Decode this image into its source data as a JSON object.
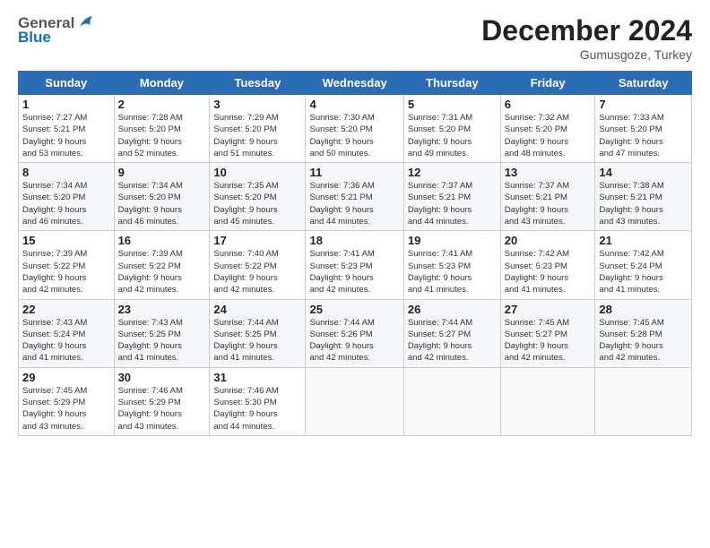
{
  "logo": {
    "line1": "General",
    "line2": "Blue"
  },
  "header": {
    "month_year": "December 2024",
    "location": "Gumusgoze, Turkey"
  },
  "days_of_week": [
    "Sunday",
    "Monday",
    "Tuesday",
    "Wednesday",
    "Thursday",
    "Friday",
    "Saturday"
  ],
  "weeks": [
    [
      {
        "day": "1",
        "info": "Sunrise: 7:27 AM\nSunset: 5:21 PM\nDaylight: 9 hours\nand 53 minutes."
      },
      {
        "day": "2",
        "info": "Sunrise: 7:28 AM\nSunset: 5:20 PM\nDaylight: 9 hours\nand 52 minutes."
      },
      {
        "day": "3",
        "info": "Sunrise: 7:29 AM\nSunset: 5:20 PM\nDaylight: 9 hours\nand 51 minutes."
      },
      {
        "day": "4",
        "info": "Sunrise: 7:30 AM\nSunset: 5:20 PM\nDaylight: 9 hours\nand 50 minutes."
      },
      {
        "day": "5",
        "info": "Sunrise: 7:31 AM\nSunset: 5:20 PM\nDaylight: 9 hours\nand 49 minutes."
      },
      {
        "day": "6",
        "info": "Sunrise: 7:32 AM\nSunset: 5:20 PM\nDaylight: 9 hours\nand 48 minutes."
      },
      {
        "day": "7",
        "info": "Sunrise: 7:33 AM\nSunset: 5:20 PM\nDaylight: 9 hours\nand 47 minutes."
      }
    ],
    [
      {
        "day": "8",
        "info": "Sunrise: 7:34 AM\nSunset: 5:20 PM\nDaylight: 9 hours\nand 46 minutes."
      },
      {
        "day": "9",
        "info": "Sunrise: 7:34 AM\nSunset: 5:20 PM\nDaylight: 9 hours\nand 46 minutes."
      },
      {
        "day": "10",
        "info": "Sunrise: 7:35 AM\nSunset: 5:20 PM\nDaylight: 9 hours\nand 45 minutes."
      },
      {
        "day": "11",
        "info": "Sunrise: 7:36 AM\nSunset: 5:21 PM\nDaylight: 9 hours\nand 44 minutes."
      },
      {
        "day": "12",
        "info": "Sunrise: 7:37 AM\nSunset: 5:21 PM\nDaylight: 9 hours\nand 44 minutes."
      },
      {
        "day": "13",
        "info": "Sunrise: 7:37 AM\nSunset: 5:21 PM\nDaylight: 9 hours\nand 43 minutes."
      },
      {
        "day": "14",
        "info": "Sunrise: 7:38 AM\nSunset: 5:21 PM\nDaylight: 9 hours\nand 43 minutes."
      }
    ],
    [
      {
        "day": "15",
        "info": "Sunrise: 7:39 AM\nSunset: 5:22 PM\nDaylight: 9 hours\nand 42 minutes."
      },
      {
        "day": "16",
        "info": "Sunrise: 7:39 AM\nSunset: 5:22 PM\nDaylight: 9 hours\nand 42 minutes."
      },
      {
        "day": "17",
        "info": "Sunrise: 7:40 AM\nSunset: 5:22 PM\nDaylight: 9 hours\nand 42 minutes."
      },
      {
        "day": "18",
        "info": "Sunrise: 7:41 AM\nSunset: 5:23 PM\nDaylight: 9 hours\nand 42 minutes."
      },
      {
        "day": "19",
        "info": "Sunrise: 7:41 AM\nSunset: 5:23 PM\nDaylight: 9 hours\nand 41 minutes."
      },
      {
        "day": "20",
        "info": "Sunrise: 7:42 AM\nSunset: 5:23 PM\nDaylight: 9 hours\nand 41 minutes."
      },
      {
        "day": "21",
        "info": "Sunrise: 7:42 AM\nSunset: 5:24 PM\nDaylight: 9 hours\nand 41 minutes."
      }
    ],
    [
      {
        "day": "22",
        "info": "Sunrise: 7:43 AM\nSunset: 5:24 PM\nDaylight: 9 hours\nand 41 minutes."
      },
      {
        "day": "23",
        "info": "Sunrise: 7:43 AM\nSunset: 5:25 PM\nDaylight: 9 hours\nand 41 minutes."
      },
      {
        "day": "24",
        "info": "Sunrise: 7:44 AM\nSunset: 5:25 PM\nDaylight: 9 hours\nand 41 minutes."
      },
      {
        "day": "25",
        "info": "Sunrise: 7:44 AM\nSunset: 5:26 PM\nDaylight: 9 hours\nand 42 minutes."
      },
      {
        "day": "26",
        "info": "Sunrise: 7:44 AM\nSunset: 5:27 PM\nDaylight: 9 hours\nand 42 minutes."
      },
      {
        "day": "27",
        "info": "Sunrise: 7:45 AM\nSunset: 5:27 PM\nDaylight: 9 hours\nand 42 minutes."
      },
      {
        "day": "28",
        "info": "Sunrise: 7:45 AM\nSunset: 5:28 PM\nDaylight: 9 hours\nand 42 minutes."
      }
    ],
    [
      {
        "day": "29",
        "info": "Sunrise: 7:45 AM\nSunset: 5:29 PM\nDaylight: 9 hours\nand 43 minutes."
      },
      {
        "day": "30",
        "info": "Sunrise: 7:46 AM\nSunset: 5:29 PM\nDaylight: 9 hours\nand 43 minutes."
      },
      {
        "day": "31",
        "info": "Sunrise: 7:46 AM\nSunset: 5:30 PM\nDaylight: 9 hours\nand 44 minutes."
      },
      null,
      null,
      null,
      null
    ]
  ]
}
